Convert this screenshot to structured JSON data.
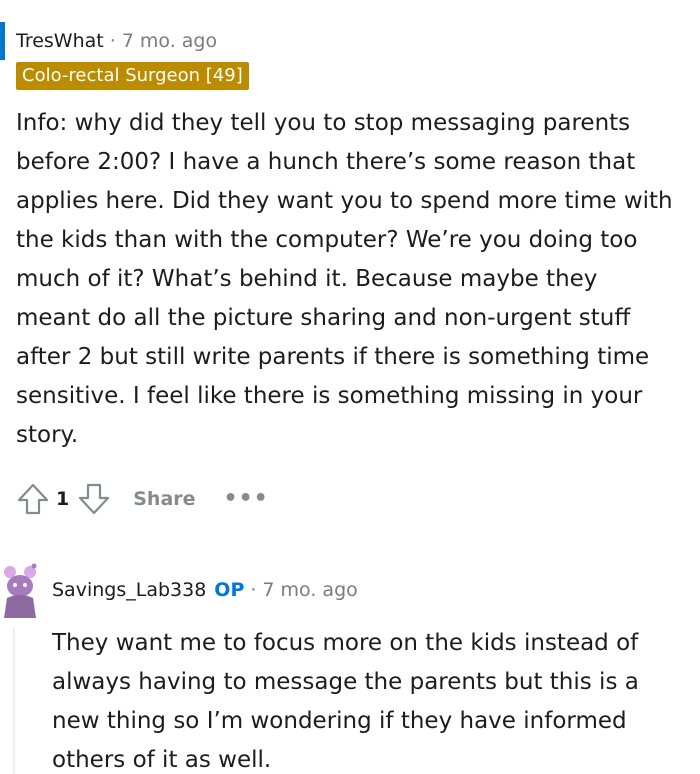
{
  "comment": {
    "username": "TresWhat",
    "time": "7 mo. ago",
    "flair": "Colo-rectal Surgeon [49]",
    "body": "Info: why did they tell you to stop messaging parents before 2:00? I have a hunch there’s some reason that applies here. Did they want you to spend more time with the kids than with the computer? We’re you doing too much of it? What’s behind it. Because maybe they meant do all the picture sharing and non-urgent stuff after 2 but still write parents if there is something time sensitive. I feel like there is something missing in your story.",
    "vote_count": "1",
    "share_label": "Share",
    "more_label": "•••",
    "separator": "·"
  },
  "reply": {
    "username": "Savings_Lab338",
    "op_label": "OP",
    "time": "7 mo. ago",
    "separator": "·",
    "body": "They want me to focus more on the kids instead of always having to message the parents but this is a new thing so I’m wondering if they have informed others of it as well."
  },
  "colors": {
    "flair_bg": "#bb8b00",
    "op_blue": "#0079d3",
    "thread_highlight": "#0079d3",
    "muted_text": "#7c7c7c"
  },
  "icons": {
    "upvote": "arrow-up-icon",
    "downvote": "arrow-down-icon",
    "share": "share-icon",
    "more": "ellipsis-icon",
    "avatar": "snoo-avatar-icon"
  }
}
